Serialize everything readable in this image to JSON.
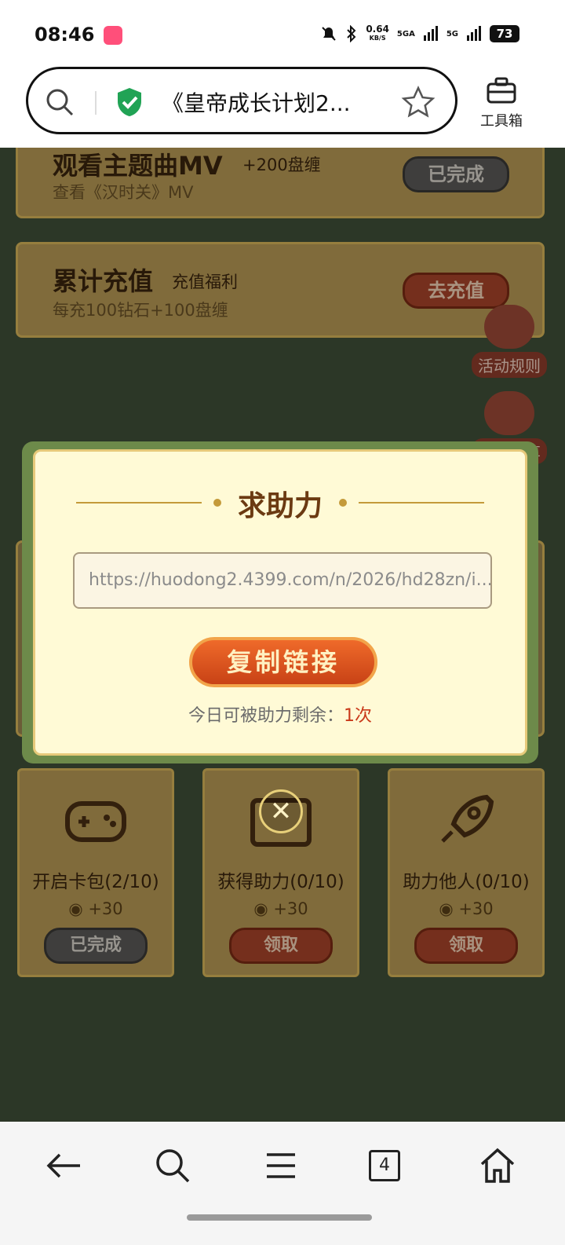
{
  "status": {
    "time": "08:46",
    "speed": "0.64",
    "speed_unit": "KB/S",
    "net1": "5GA",
    "net2": "5G",
    "battery": "73"
  },
  "browser": {
    "url_title": "《皇帝成长计划2...",
    "toolbox_label": "工具箱",
    "tab_count": "4"
  },
  "cards": [
    {
      "title": "观看主题曲MV",
      "reward": "+200盘缠",
      "desc": "查看《汉时关》MV",
      "button": "已完成"
    },
    {
      "title": "累计充值",
      "reward": "充值福利",
      "desc": "每充100钻石+100盘缠",
      "button": "去充值"
    }
  ],
  "side": {
    "rules": "活动规则",
    "share": "活动分享"
  },
  "tasks": [
    {
      "label": "开启卡包(2/10)",
      "reward": "+30",
      "button": "已完成",
      "icon": "gamepad-icon"
    },
    {
      "label": "获得助力(0/10)",
      "reward": "+30",
      "button": "领取",
      "icon": "help-icon"
    },
    {
      "label": "助力他人(0/10)",
      "reward": "+30",
      "button": "领取",
      "icon": "rocket-icon"
    }
  ],
  "dialog": {
    "title": "求助力",
    "link": "https://huodong2.4399.com/n/2026/hd28zn/i...",
    "copy_button": "复制链接",
    "remain_prefix": "今日可被助力剩余：",
    "remain_count": "1次"
  }
}
